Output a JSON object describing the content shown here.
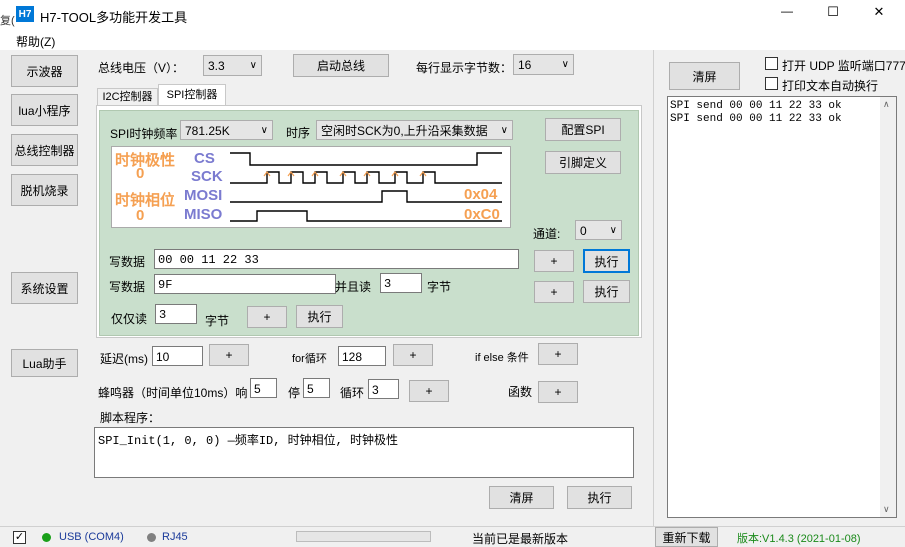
{
  "window": {
    "icon_text": "H7",
    "title": "H7-TOOL多功能开发工具",
    "left_edge_char": "复(",
    "controls": {
      "minimize": "—",
      "maximize": "☐",
      "close": "✕"
    }
  },
  "menu": {
    "help": "帮助(Z)"
  },
  "sidebar": {
    "items": [
      {
        "label": "示波器"
      },
      {
        "label": "lua小程序"
      },
      {
        "label": "总线控制器"
      },
      {
        "label": "脱机烧录"
      },
      {
        "label": "系统设置"
      },
      {
        "label": "Lua助手"
      }
    ]
  },
  "topbar": {
    "voltage_label": "总线电压（V）：",
    "voltage_value": "3.3",
    "start_bus": "启动总线",
    "bytes_label": "每行显示字节数：",
    "bytes_value": "16"
  },
  "tabs": [
    {
      "label": "I2C控制器"
    },
    {
      "label": "SPI控制器"
    }
  ],
  "spi": {
    "freq_label": "SPI时钟频率",
    "freq_value": "781.25K",
    "timing_label": "时序",
    "timing_value": "空闲时SCK为0,上升沿采集数据",
    "config_btn": "配置SPI",
    "pin_btn": "引脚定义",
    "diagram": {
      "cpol_label": "时钟极性",
      "cpol_value": "0",
      "cpha_label": "时钟相位",
      "cpha_value": "0",
      "cs": "CS",
      "sck": "SCK",
      "mosi": "MOSI",
      "miso": "MISO",
      "mosi_hex": "0x04",
      "miso_hex": "0xC0"
    },
    "channel_label": "通道:",
    "channel_value": "0",
    "write1_label": "写数据",
    "write1_value": "00 00 11 22 33",
    "plus": "+",
    "exec": "执行",
    "write2_label": "写数据",
    "write2_value": "9F",
    "and_read_label": "并且读",
    "and_read_value": "3",
    "bytes_unit": "字节",
    "read_only_label": "仅仅读",
    "read_only_value": "3",
    "read_only_unit": "字节"
  },
  "script": {
    "delay_label": "延迟(ms)",
    "delay_value": "10",
    "for_label": "for循环",
    "for_value": "128",
    "ifelse_label": "if else 条件",
    "buzzer_label": "蜂鸣器（时间单位10ms）响",
    "buzzer_on": "5",
    "stop_label": "停",
    "stop_value": "5",
    "loop_label": "循环",
    "loop_value": "3",
    "func_label": "函数",
    "program_label": "脚本程序：",
    "program_text": "SPI_Init(1, 0, 0) —频率ID, 时钟相位, 时钟极性",
    "clear": "清屏",
    "run": "执行"
  },
  "right": {
    "clear": "清屏",
    "udp_label": "打开 UDP 监听端口777",
    "print_wrap_label": "打印文本自动换行",
    "log": [
      "SPI send 00 00 11 22 33  ok",
      "SPI send 00 00 11 22 33  ok"
    ]
  },
  "status": {
    "usb": "USB (COM4)",
    "usb_color": "#1aa01a",
    "rj45": "RJ45",
    "rj45_color": "#808080",
    "latest": "当前已是最新版本",
    "redownload": "重新下载",
    "version": "版本:V1.4.3 (2021-01-08)",
    "version_color": "#1a8a1a"
  }
}
